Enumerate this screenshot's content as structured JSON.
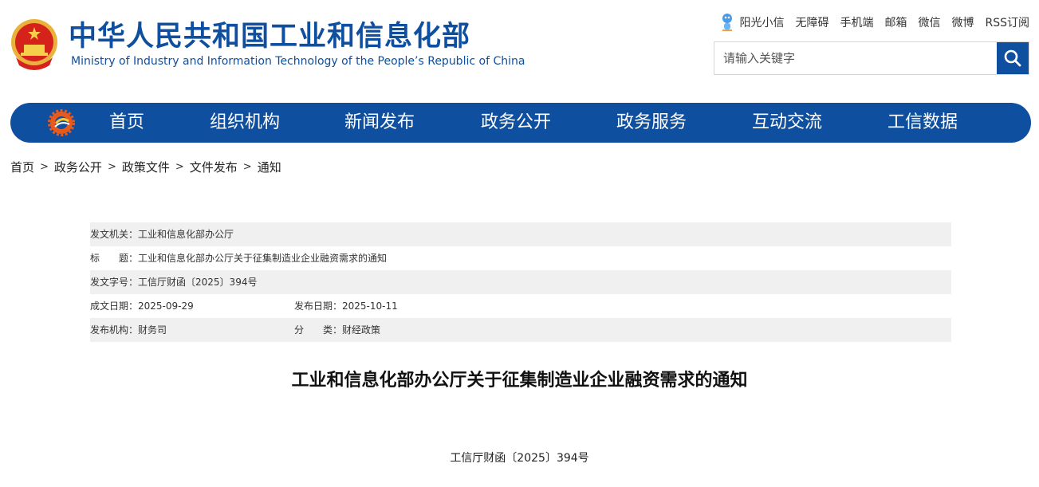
{
  "header": {
    "title_cn": "中华人民共和国工业和信息化部",
    "title_en": "Ministry of Industry and Information Technology of the People’s Republic of China",
    "emblem_icon": "national-emblem-icon",
    "brand_color": "#0f4fa0",
    "emblem_red": "#d5231c",
    "emblem_gold": "#e9b23a"
  },
  "toplinks": [
    {
      "label": "阳光小信"
    },
    {
      "label": "无障碍"
    },
    {
      "label": "手机端"
    },
    {
      "label": "邮箱"
    },
    {
      "label": "微信"
    },
    {
      "label": "微博"
    },
    {
      "label": "RSS订阅"
    }
  ],
  "search": {
    "placeholder": "请输入关键字",
    "icon": "search-icon"
  },
  "nav": {
    "items": [
      {
        "label": "首页"
      },
      {
        "label": "组织机构"
      },
      {
        "label": "新闻发布"
      },
      {
        "label": "政务公开"
      },
      {
        "label": "政务服务"
      },
      {
        "label": "互动交流"
      },
      {
        "label": "工信数据"
      }
    ]
  },
  "breadcrumb": {
    "separator": ">",
    "items": [
      "首页",
      "政务公开",
      "政策文件",
      "文件发布",
      "通知"
    ]
  },
  "meta": {
    "issuer": {
      "label": "发文机关：",
      "value": "工业和信息化部办公厅"
    },
    "title": {
      "label": "标　　题：",
      "value": "工业和信息化部办公厅关于征集制造业企业融资需求的通知"
    },
    "doc_no": {
      "label": "发文字号：",
      "value": "工信厅财函〔2025〕394号"
    },
    "created": {
      "label": "成文日期：",
      "value": "2025-09-29"
    },
    "published": {
      "label": "发布日期：",
      "value": "2025-10-11"
    },
    "agency": {
      "label": "发布机构：",
      "value": "财务司"
    },
    "category": {
      "label": "分　　类：",
      "value": "财经政策"
    }
  },
  "article": {
    "title": "工业和信息化部办公厅关于征集制造业企业融资需求的通知",
    "doc_number": "工信厅财函〔2025〕394号"
  }
}
